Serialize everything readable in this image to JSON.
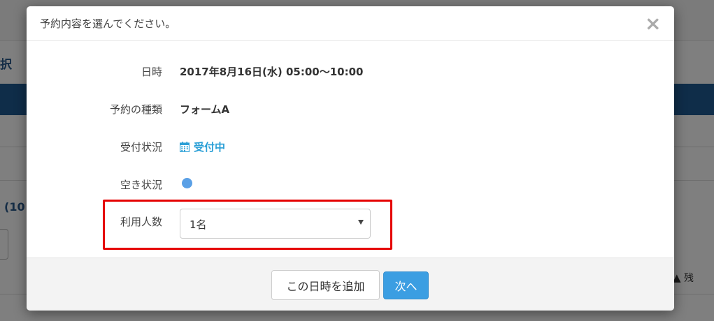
{
  "background": {
    "left_text": "択",
    "left_count": "(10",
    "right_legend_symbol": "▲",
    "right_legend_text": "残"
  },
  "modal": {
    "title": "予約内容を選んでください。",
    "close_symbol": "×",
    "fields": {
      "datetime": {
        "label": "日時",
        "value": "2017年8月16日(水) 05:00〜10:00"
      },
      "type": {
        "label": "予約の種類",
        "value": "フォームA"
      },
      "status": {
        "label": "受付状況",
        "value": "受付中",
        "icon": "calendar-icon"
      },
      "availability": {
        "label": "空き状況",
        "indicator_color": "#5aa0e6"
      },
      "people": {
        "label": "利用人数",
        "selected": "1名"
      }
    },
    "footer": {
      "add_datetime_label": "この日時を追加",
      "next_label": "次へ"
    }
  },
  "colors": {
    "accent": "#3b9ee2",
    "status_text": "#2a9fd6",
    "highlight": "#e50000"
  }
}
